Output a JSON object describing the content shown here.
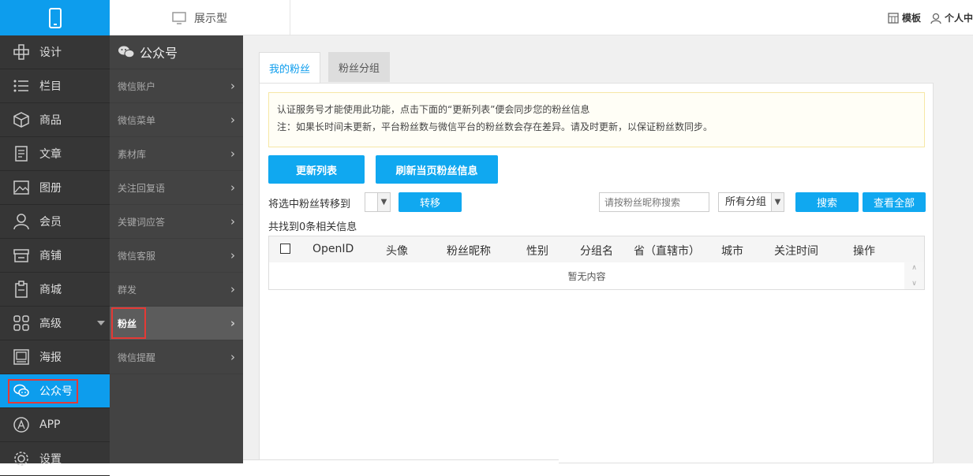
{
  "topbar": {
    "display_type": "展示型",
    "template_label": "模板",
    "profile_label": "个人中"
  },
  "sidebar": {
    "items": [
      {
        "label": "设计",
        "icon": "design-icon"
      },
      {
        "label": "栏目",
        "icon": "list-icon"
      },
      {
        "label": "商品",
        "icon": "box-icon"
      },
      {
        "label": "文章",
        "icon": "document-icon"
      },
      {
        "label": "图册",
        "icon": "image-icon"
      },
      {
        "label": "会员",
        "icon": "user-icon"
      },
      {
        "label": "商铺",
        "icon": "store-icon"
      },
      {
        "label": "商城",
        "icon": "clipboard-icon"
      },
      {
        "label": "高级",
        "icon": "grid-icon"
      },
      {
        "label": "海报",
        "icon": "poster-icon"
      },
      {
        "label": "公众号",
        "icon": "wechat-icon"
      },
      {
        "label": "APP",
        "icon": "app-icon"
      },
      {
        "label": "设置",
        "icon": "gear-icon"
      }
    ]
  },
  "subnav": {
    "title": "公众号",
    "items": [
      "微信账户",
      "微信菜单",
      "素材库",
      "关注回复语",
      "关键词应答",
      "微信客服",
      "群发",
      "粉丝",
      "微信提醒"
    ]
  },
  "tabs": [
    "我的粉丝",
    "粉丝分组"
  ],
  "notice": {
    "line1": "认证服务号才能使用此功能，点击下面的“更新列表”便会同步您的粉丝信息",
    "line2": "注：如果长时间未更新，平台粉丝数与微信平台的粉丝数会存在差异。请及时更新，以保证粉丝数同步。"
  },
  "actions": {
    "update_list": "更新列表",
    "refresh_page": "刷新当页粉丝信息",
    "move_label": "将选中粉丝转移到",
    "move_button": "转移",
    "search_placeholder": "请按粉丝昵称搜索",
    "group_selected": "所有分组",
    "search_button": "搜索",
    "view_all": "查看全部"
  },
  "result_count": "共找到0条相关信息",
  "table": {
    "columns": [
      "OpenID",
      "头像",
      "粉丝昵称",
      "性别",
      "分组名",
      "省（直辖市）",
      "城市",
      "关注时间",
      "操作"
    ],
    "empty_text": "暂无内容"
  },
  "colors": {
    "accent": "#0d9ded",
    "sidebar_bg": "#363636",
    "subnav_bg": "#434343",
    "highlight": "#e53935"
  }
}
